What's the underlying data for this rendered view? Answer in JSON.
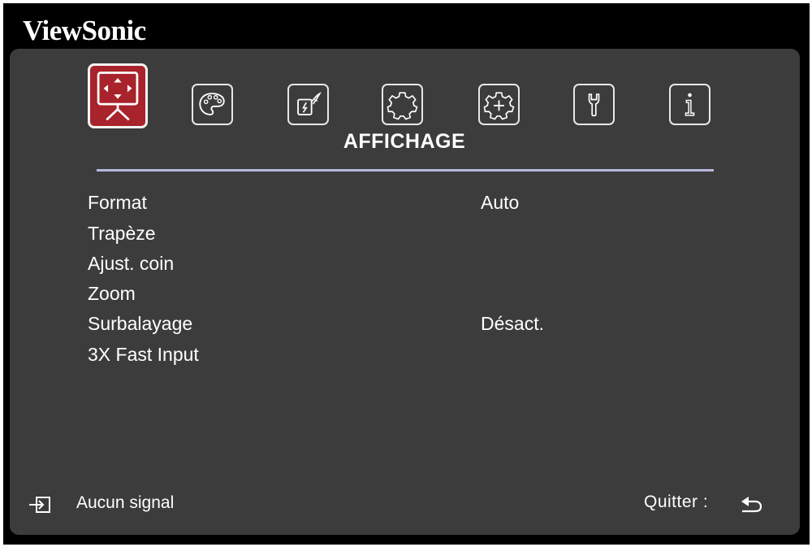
{
  "brand": "ViewSonic",
  "menu": {
    "tabs": [
      {
        "name": "display",
        "icon": "projector-screen-icon",
        "active": true
      },
      {
        "name": "image",
        "icon": "palette-icon",
        "active": false
      },
      {
        "name": "power",
        "icon": "power-management-icon",
        "active": false
      },
      {
        "name": "basic",
        "icon": "gear-icon",
        "active": false
      },
      {
        "name": "advanced",
        "icon": "advanced-gear-icon",
        "active": false
      },
      {
        "name": "system",
        "icon": "wrench-icon",
        "active": false
      },
      {
        "name": "information",
        "icon": "info-icon",
        "active": false
      }
    ],
    "section_title": "AFFICHAGE",
    "items": [
      {
        "label": "Format",
        "value": "Auto"
      },
      {
        "label": "Trapèze",
        "value": ""
      },
      {
        "label": "Ajust. coin",
        "value": ""
      },
      {
        "label": "Zoom",
        "value": ""
      },
      {
        "label": "Surbalayage",
        "value": "Désact."
      },
      {
        "label": "3X Fast Input",
        "value": ""
      }
    ]
  },
  "footer": {
    "source_status": "Aucun signal",
    "exit_label": "Quitter :"
  },
  "colors": {
    "panel": "#3c3c3c",
    "active_tab": "#a8232b",
    "divider": "#b7b7e0",
    "text": "#ffffff"
  }
}
